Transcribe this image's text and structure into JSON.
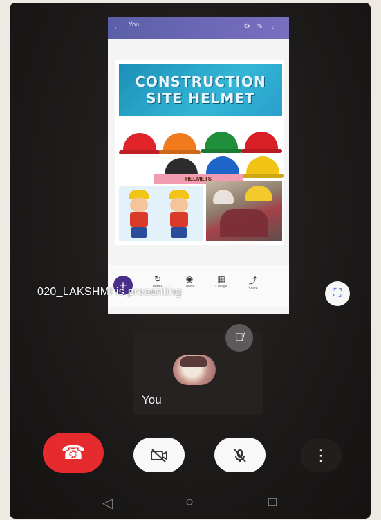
{
  "shared_screen": {
    "app_title": "You",
    "banner_line1": "CONSTRUCTION",
    "banner_line2": "SITE HELMET",
    "helmet_label": "HELMETS",
    "toolbar": [
      {
        "icon": "↻",
        "label": "Rotate"
      },
      {
        "icon": "◉",
        "label": "Delete"
      },
      {
        "icon": "▦",
        "label": "Collage"
      },
      {
        "icon": "⤴",
        "label": "Share"
      }
    ],
    "helmet_colors": [
      "#e0242a",
      "#f07a1c",
      "#1f8f3a",
      "#d81f26",
      "#2c2c2c",
      "#1f64c8",
      "#f2c416"
    ]
  },
  "presenter_text": "020_LAKSHMI is presenting",
  "self_tile": {
    "name": "You"
  },
  "controls": {
    "end_call_icon": "phone-hangup-icon",
    "camera_icon": "camera-off-icon",
    "mic_icon": "mic-off-icon",
    "more_icon": "more-vert-icon"
  },
  "nav": {
    "back": "◁",
    "home": "○",
    "recents": "□"
  }
}
